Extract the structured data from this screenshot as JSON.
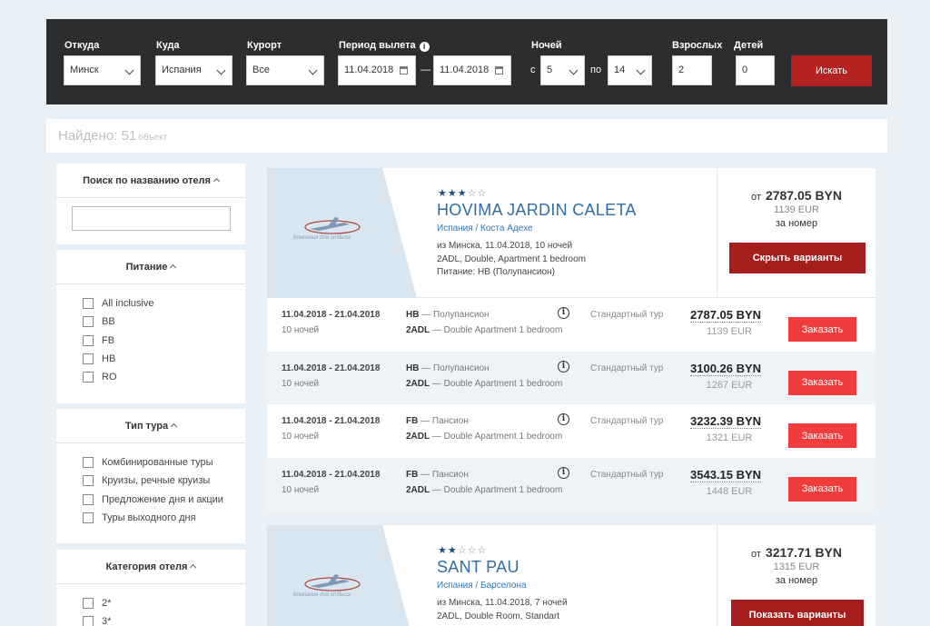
{
  "search": {
    "from_label": "Откуда",
    "from_value": "Минск",
    "to_label": "Куда",
    "to_value": "Испания",
    "resort_label": "Курорт",
    "resort_value": "Все",
    "period_label": "Период вылета",
    "date_from": "11.04.2018",
    "date_sep": "—",
    "date_to": "11.04.2018",
    "nights_label": "Ночей",
    "nights_from_prefix": "с",
    "nights_from": "5",
    "nights_to_prefix": "по",
    "nights_to": "14",
    "adults_label": "Взрослых",
    "adults": "2",
    "children_label": "Детей",
    "children": "0",
    "search_button": "Искать"
  },
  "found": {
    "label": "Найдено: 51",
    "unit": "объект"
  },
  "filters": {
    "hotel_search": {
      "title": "Поиск по названию отеля",
      "value": ""
    },
    "meal": {
      "title": "Питание",
      "options": [
        "All inclusive",
        "BB",
        "FB",
        "HB",
        "RO"
      ]
    },
    "tour_type": {
      "title": "Тип тура",
      "options": [
        "Комбинированные туры",
        "Круизы, речные круизы",
        "Предложение дня и акции",
        "Туры выходного дня"
      ]
    },
    "category": {
      "title": "Категория отеля",
      "options": [
        "2*",
        "3*"
      ]
    }
  },
  "hotels": [
    {
      "stars_on": "★★★",
      "stars_off": "☆☆",
      "name": "HOVIMA JARDIN CALETA",
      "location": "Испания / Коста Адехе",
      "details": [
        "из Минска, 11.04.2018, 10 ночей",
        "2ADL, Double, Apartment 1 bedroom",
        "Питание: HB (Полупансион)"
      ],
      "price_prefix": "от",
      "price": "2787.05 BYN",
      "price_eur": "1139 EUR",
      "price_per": "за номер",
      "variants_button": "Скрыть варианты",
      "logo_sub": "Компания для отдыха",
      "offers": [
        {
          "dates": "11.04.2018 - 21.04.2018",
          "nights": "10 ночей",
          "meal_code": "HB",
          "meal_name": " — Полупансион",
          "room_code": "2ADL",
          "room_name": " — Double Apartment 1 bedroom",
          "type": "Стандартный тур",
          "price": "2787.05 BYN",
          "eur": "1139 EUR",
          "button": "Заказать"
        },
        {
          "dates": "11.04.2018 - 21.04.2018",
          "nights": "10 ночей",
          "meal_code": "HB",
          "meal_name": " — Полупансион",
          "room_code": "2ADL",
          "room_name": " — Double Apartment 1 bedroom",
          "type": "Стандартный тур",
          "price": "3100.26 BYN",
          "eur": "1267 EUR",
          "button": "Заказать"
        },
        {
          "dates": "11.04.2018 - 21.04.2018",
          "nights": "10 ночей",
          "meal_code": "FB",
          "meal_name": " — Пансион",
          "room_code": "2ADL",
          "room_name": " — Double Apartment 1 bedroom",
          "type": "Стандартный тур",
          "price": "3232.39 BYN",
          "eur": "1321 EUR",
          "button": "Заказать"
        },
        {
          "dates": "11.04.2018 - 21.04.2018",
          "nights": "10 ночей",
          "meal_code": "FB",
          "meal_name": " — Пансион",
          "room_code": "2ADL",
          "room_name": " — Double Apartment 1 bedroom",
          "type": "Стандартный тур",
          "price": "3543.15 BYN",
          "eur": "1448 EUR",
          "button": "Заказать"
        }
      ]
    },
    {
      "stars_on": "★★",
      "stars_off": "☆☆☆",
      "name": "SANT PAU",
      "location": "Испания / Барселона",
      "details": [
        "из Минска, 11.04.2018, 7 ночей",
        "2ADL, Double Room, Standart"
      ],
      "price_prefix": "от",
      "price": "3217.71 BYN",
      "price_eur": "1315 EUR",
      "price_per": "за номер",
      "variants_button": "Показать варианты",
      "logo_sub": "Компания для отдыха"
    }
  ],
  "colors": {
    "accent": "#a51e1e",
    "order": "#f03c3c",
    "link": "#2f6ea6",
    "dark_bar": "#2c2d2f"
  }
}
